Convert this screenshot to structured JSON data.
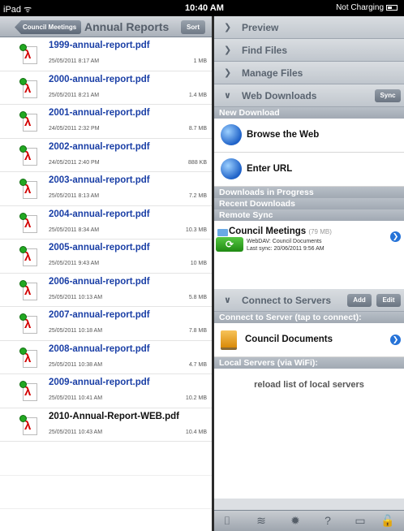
{
  "status_bar": {
    "device": "iPad ᯤ",
    "time": "10:40 AM",
    "battery": "Not Charging"
  },
  "left_nav": {
    "back_label": "Council Meetings",
    "title": "Annual Reports",
    "sort_label": "Sort"
  },
  "files": [
    {
      "name": "1999-annual-report.pdf",
      "date": "25/05/2011 8:17 AM",
      "size": "1 MB"
    },
    {
      "name": "2000-annual-report.pdf",
      "date": "25/05/2011 8:21 AM",
      "size": "1.4 MB"
    },
    {
      "name": "2001-annual-report.pdf",
      "date": "24/05/2011 2:32 PM",
      "size": "8.7 MB"
    },
    {
      "name": "2002-annual-report.pdf",
      "date": "24/05/2011 2:40 PM",
      "size": "888 KB"
    },
    {
      "name": "2003-annual-report.pdf",
      "date": "25/05/2011 8:13 AM",
      "size": "7.2 MB"
    },
    {
      "name": "2004-annual-report.pdf",
      "date": "25/05/2011 8:34 AM",
      "size": "10.3 MB"
    },
    {
      "name": "2005-annual-report.pdf",
      "date": "25/05/2011 9:43 AM",
      "size": "10 MB"
    },
    {
      "name": "2006-annual-report.pdf",
      "date": "25/05/2011 10:13 AM",
      "size": "5.8 MB"
    },
    {
      "name": "2007-annual-report.pdf",
      "date": "25/05/2011 10:18 AM",
      "size": "7.8 MB"
    },
    {
      "name": "2008-annual-report.pdf",
      "date": "25/05/2011 10:38 AM",
      "size": "4.7 MB"
    },
    {
      "name": "2009-annual-report.pdf",
      "date": "25/05/2011 10:41 AM",
      "size": "10.2 MB"
    },
    {
      "name": "2010-Annual-Report-WEB.pdf",
      "date": "25/05/2011 10:43 AM",
      "size": "10.4 MB"
    }
  ],
  "right_sections": {
    "preview": "Preview",
    "find_files": "Find Files",
    "manage_files": "Manage Files",
    "web_downloads": "Web Downloads",
    "sync_label": "Sync"
  },
  "new_download": {
    "header": "New Download",
    "browse": "Browse the Web",
    "enter_url": "Enter URL"
  },
  "headers": {
    "in_progress": "Downloads in Progress",
    "recent": "Recent Downloads",
    "remote_sync": "Remote Sync"
  },
  "remote_sync": {
    "title": "Council Meetings",
    "size": "(79 MB)",
    "source": "WebDAV: Council Documents",
    "last_sync": "Last sync: 20/06/2011 9:56 AM"
  },
  "servers": {
    "section": "Connect to Servers",
    "add_label": "Add",
    "edit_label": "Edit",
    "connect_header": "Connect to Server (tap to connect):",
    "server_name": "Council Documents",
    "local_header": "Local Servers (via WiFi):",
    "reload": "reload list of local servers"
  },
  "toolbar_icons": [
    "camera-icon",
    "wifi-icon",
    "gear-icon",
    "help-icon",
    "display-icon",
    "lock-icon"
  ],
  "toolbar_glyphs": [
    "⌷",
    "≋",
    "✹",
    "?",
    "▭",
    "🔓"
  ]
}
